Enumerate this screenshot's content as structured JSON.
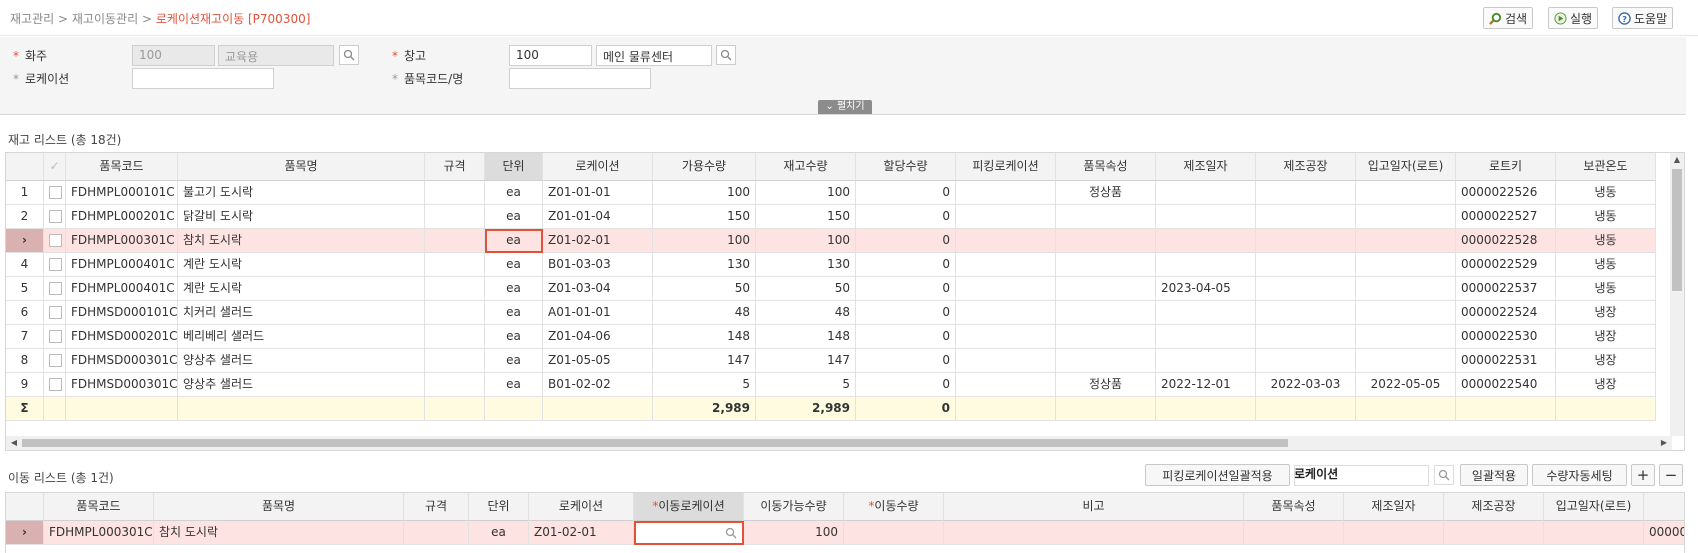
{
  "breadcrumb": {
    "lvl1": "재고관리",
    "sep": ">",
    "lvl2": "재고이동관리",
    "current": "로케이션재고이동 [P700300]"
  },
  "toolbar": {
    "search": "검색",
    "run": "실행",
    "help": "도움말"
  },
  "form": {
    "owner_label": "화주",
    "owner_code": "100",
    "owner_name": "교육용",
    "warehouse_label": "창고",
    "warehouse_code": "100",
    "warehouse_name": "메인 물류센터",
    "location_label": "로케이션",
    "location_value": "",
    "item_label": "품목코드/명",
    "item_value": "",
    "expand": "펼치기"
  },
  "stock": {
    "title": "재고 리스트 (총 18건)",
    "columns": [
      "",
      "",
      "품목코드",
      "품목명",
      "규격",
      "단위",
      "로케이션",
      "가용수량",
      "재고수량",
      "할당수량",
      "피킹로케이션",
      "품목속성",
      "제조일자",
      "제조공장",
      "입고일자(로트)",
      "로트키",
      "보관온도"
    ],
    "rows": [
      [
        "1",
        "",
        "FDHMPL000101C",
        "불고기 도시락",
        "",
        "ea",
        "Z01-01-01",
        "100",
        "100",
        "0",
        "",
        "정상품",
        "",
        "",
        "",
        "0000022526",
        "냉동"
      ],
      [
        "2",
        "",
        "FDHMPL000201C",
        "닭갈비 도시락",
        "",
        "ea",
        "Z01-01-04",
        "150",
        "150",
        "0",
        "",
        "",
        "",
        "",
        "",
        "0000022527",
        "냉동"
      ],
      [
        "",
        "",
        "FDHMPL000301C",
        "참치 도시락",
        "",
        "ea",
        "Z01-02-01",
        "100",
        "100",
        "0",
        "",
        "",
        "",
        "",
        "",
        "0000022528",
        "냉동"
      ],
      [
        "4",
        "",
        "FDHMPL000401C",
        "계란 도시락",
        "",
        "ea",
        "B01-03-03",
        "130",
        "130",
        "0",
        "",
        "",
        "",
        "",
        "",
        "0000022529",
        "냉동"
      ],
      [
        "5",
        "",
        "FDHMPL000401C",
        "계란 도시락",
        "",
        "ea",
        "Z01-03-04",
        "50",
        "50",
        "0",
        "",
        "",
        "2023-04-05",
        "",
        "",
        "0000022537",
        "냉동"
      ],
      [
        "6",
        "",
        "FDHMSD000101C",
        "치커리 샐러드",
        "",
        "ea",
        "A01-01-01",
        "48",
        "48",
        "0",
        "",
        "",
        "",
        "",
        "",
        "0000022524",
        "냉장"
      ],
      [
        "7",
        "",
        "FDHMSD000201C",
        "베리베리 샐러드",
        "",
        "ea",
        "Z01-04-06",
        "148",
        "148",
        "0",
        "",
        "",
        "",
        "",
        "",
        "0000022530",
        "냉장"
      ],
      [
        "8",
        "",
        "FDHMSD000301C",
        "양상추 샐러드",
        "",
        "ea",
        "Z01-05-05",
        "147",
        "147",
        "0",
        "",
        "",
        "",
        "",
        "",
        "0000022531",
        "냉장"
      ],
      [
        "9",
        "",
        "FDHMSD000301C",
        "양상추 샐러드",
        "",
        "ea",
        "B01-02-02",
        "5",
        "5",
        "0",
        "",
        "정상품",
        "2022-12-01",
        "2022-03-03",
        "2022-05-05",
        "0000022540",
        "냉장"
      ]
    ],
    "sum_symbol": "Σ",
    "sum": {
      "avail": "2,989",
      "stock": "2,989",
      "alloc": "0"
    }
  },
  "move": {
    "title": "이동 리스트 (총 1건)",
    "bulk_pick_btn": "피킹로케이션일괄적용",
    "location_label": "로케이션",
    "apply_btn": "일괄적용",
    "auto_qty_btn": "수량자동세팅",
    "add": "+",
    "remove": "−",
    "columns": [
      "",
      "품목코드",
      "품목명",
      "규격",
      "단위",
      "로케이션",
      "이동로케이션",
      "이동가능수량",
      "이동수량",
      "비고",
      "품목속성",
      "제조일자",
      "제조공장",
      "입고일자(로트)",
      ""
    ],
    "rows": [
      [
        "",
        "FDHMPL000301C",
        "참치 도시락",
        "",
        "ea",
        "Z01-02-01",
        "",
        "100",
        "",
        "",
        "",
        "",
        "",
        "",
        "00000"
      ]
    ]
  },
  "colors": {
    "accent": "#e0523a",
    "selected_row": "#fde3e2",
    "sum_row": "#fffbe0"
  }
}
